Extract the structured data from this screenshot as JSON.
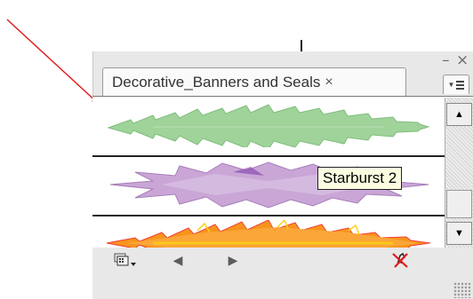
{
  "window": {
    "minimize_label": "–",
    "close_label": "×"
  },
  "panel": {
    "tab_title": "Decorative_Banners and Seals",
    "tab_close": "×",
    "menu_icon": "panel-menu-icon"
  },
  "items": [
    {
      "icon": "green-starburst-banner",
      "color": "#9fd39a"
    },
    {
      "icon": "purple-starburst-banner",
      "color": "#c9a6d6"
    },
    {
      "icon": "orange-starburst-banner",
      "color": "#f7941d"
    }
  ],
  "tooltip": {
    "text": "Starburst 2"
  },
  "bottom_toolbar": {
    "icons": [
      "library-menu-icon",
      "previous-arrow-icon",
      "next-arrow-icon",
      "break-link-icon"
    ]
  },
  "scrollbar": {
    "up_icon": "scroll-up-arrow-icon",
    "down_icon": "scroll-down-arrow-icon"
  },
  "annotation": {
    "arrow_color": "#e01b1b"
  }
}
